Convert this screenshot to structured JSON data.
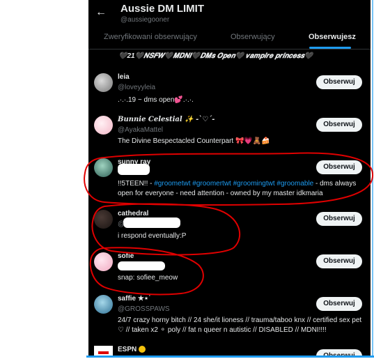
{
  "header": {
    "back_icon": "arrow-left-icon",
    "title": "Aussie DM LIMIT",
    "handle": "@aussiegooner"
  },
  "tabs": [
    {
      "label": "Zweryfikowani obserwujący",
      "active": false
    },
    {
      "label": "Obserwujący",
      "active": false
    },
    {
      "label": "Obserwujesz",
      "active": true
    }
  ],
  "top_bio": "🖤21🖤𝑵𝑺𝑭𝑾🖤𝑴𝑫𝑵𝑰🖤𝑫𝑴𝒔 𝑶𝒑𝒆𝒏🖤 𝒗𝒂𝒎𝒑𝒊𝒓𝒆 𝒑𝒓𝒊𝒏𝒄𝒆𝒔𝒔🖤",
  "follow_label": "Obserwuj",
  "users": [
    {
      "name": "leia",
      "handle": "@loveyyleia",
      "bio": ".·.·.19 ~ dms open💕.·.·."
    },
    {
      "name": "𝑩𝒖𝒏𝒏𝒊𝒆 𝑪𝒆𝒍𝒆𝒔𝒕𝒊𝒂𝒍 ✨ -ˋ♡ˊ-",
      "handle": "@AyakaMattel",
      "bio": "The Divine Bespectacled Counterpart 🎀💗🧸🍰"
    },
    {
      "name": "sunny ray",
      "handle": "",
      "bio_prefix": "!!5TEEN!! - ",
      "bio_tags": "#groometwt #groomertwt  #groomingtwt #groomable",
      "bio_suffix": " - dms always open for everyone - need attention - owned by my master idkmaria"
    },
    {
      "name": "cathedral",
      "handle": "@",
      "bio": "i respond eventually:P"
    },
    {
      "name": "sofie",
      "handle": "",
      "bio": "snap: sofiee_meow"
    },
    {
      "name": "saffie ★⋆˙",
      "handle": "@GROSSPAWS",
      "bio": "24/7 crazy horny bitch // 24 she/it lioness // trauma/taboo knx // certified sex pet ♡ // taken x2 ⚬ poly // fat n queer n autistic // DISABLED // MDNI!!!!"
    },
    {
      "name": "ESPN",
      "handle": "",
      "bio": ""
    }
  ],
  "colors": {
    "accent": "#1d9bf0",
    "background": "#000000",
    "annotation": "#e00000"
  }
}
